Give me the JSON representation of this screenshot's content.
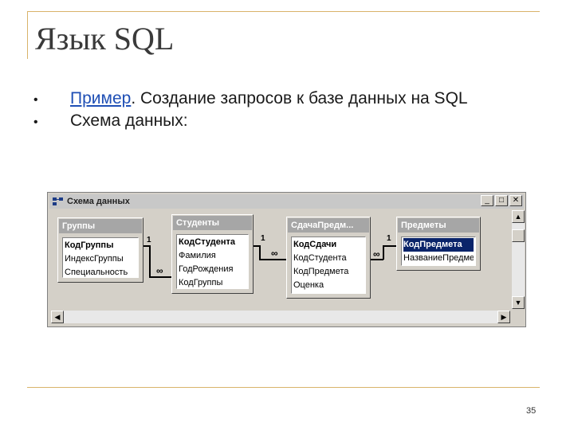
{
  "slide": {
    "title": "Язык SQL",
    "bullet_symbol": "•",
    "bullets": [
      {
        "link": "Пример",
        "text": ". Создание запросов к базе данных на SQL"
      },
      {
        "link": "",
        "text": "Схема данных:"
      }
    ],
    "page_number": "35"
  },
  "window": {
    "title": "Схема данных",
    "buttons": {
      "minimize": "_",
      "maximize": "□",
      "close": "✕"
    }
  },
  "tables": [
    {
      "title": "Группы",
      "fields": [
        "КодГруппы",
        "ИндексГруппы",
        "Специальность"
      ],
      "key": 0
    },
    {
      "title": "Студенты",
      "fields": [
        "КодСтудента",
        "Фамилия",
        "ГодРождения",
        "КодГруппы"
      ],
      "key": 0
    },
    {
      "title": "СдачаПредм...",
      "fields": [
        "КодСдачи",
        "КодСтудента",
        "КодПредмета",
        "Оценка"
      ],
      "key": 0
    },
    {
      "title": "Предметы",
      "fields": [
        "КодПредмета",
        "НазваниеПредме"
      ],
      "key": 0,
      "selected": 0
    }
  ],
  "relations": [
    {
      "one": "1",
      "many": "∞"
    },
    {
      "one": "1",
      "many": "∞"
    },
    {
      "one": "1",
      "many": "∞"
    }
  ],
  "scroll": {
    "up": "▲",
    "down": "▼",
    "left": "◀",
    "right": "▶"
  }
}
